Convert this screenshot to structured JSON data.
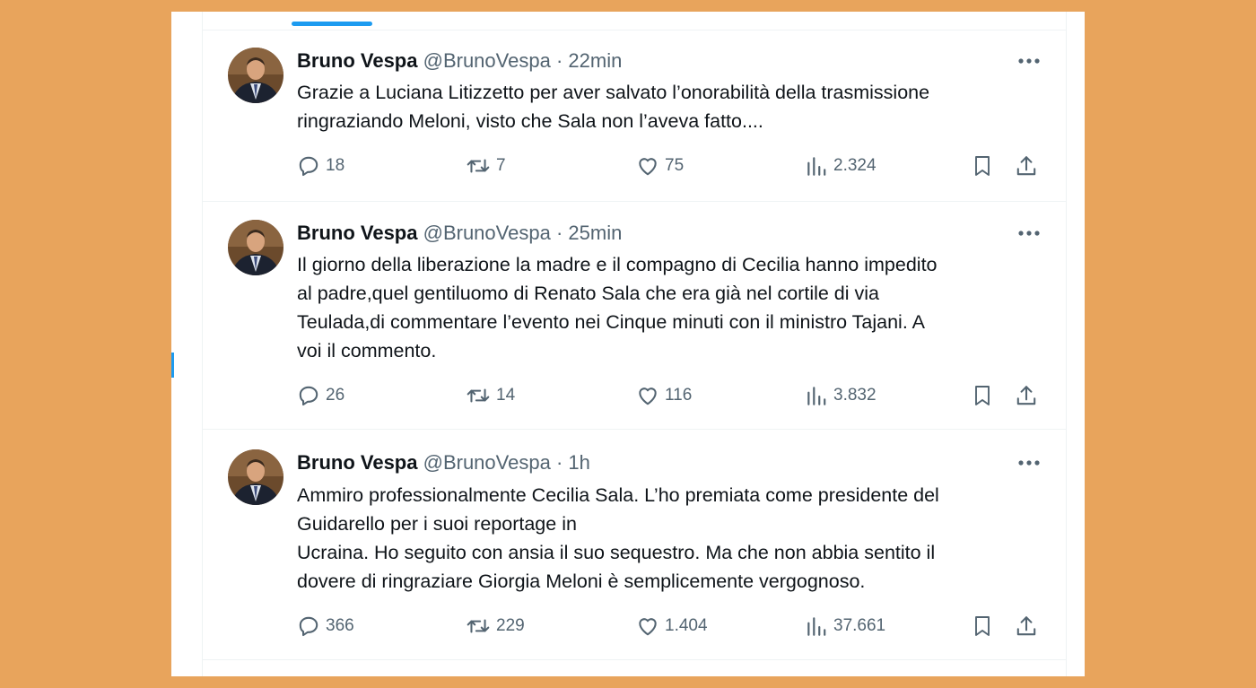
{
  "tweets": [
    {
      "author_name": "Bruno Vespa",
      "author_handle": "@BrunoVespa",
      "separator": "·",
      "time": "22min",
      "text": "Grazie a Luciana Litizzetto per aver salvato l’onorabilità della trasmissione\nringraziando Meloni, visto che Sala non l’aveva fatto....",
      "replies": "18",
      "retweets": "7",
      "likes": "75",
      "views": "2.324"
    },
    {
      "author_name": "Bruno Vespa",
      "author_handle": "@BrunoVespa",
      "separator": "·",
      "time": "25min",
      "text": "Il giorno della liberazione la madre e il compagno di Cecilia hanno impedito\nal padre,quel gentiluomo di Renato Sala che era già nel cortile di via\nTeulada,di commentare l’evento nei Cinque minuti con il ministro Tajani. A\nvoi il commento.",
      "replies": "26",
      "retweets": "14",
      "likes": "116",
      "views": "3.832"
    },
    {
      "author_name": "Bruno Vespa",
      "author_handle": "@BrunoVespa",
      "separator": "·",
      "time": "1h",
      "text": "Ammiro professionalmente Cecilia Sala. L’ho premiata come presidente del\nGuidarello per i suoi reportage in\nUcraina. Ho seguito con ansia il suo sequestro. Ma che non abbia sentito il\ndovere di ringraziare Giorgia Meloni è semplicemente vergognoso.",
      "replies": "366",
      "retweets": "229",
      "likes": "1.404",
      "views": "37.661"
    }
  ],
  "icons": {
    "more": "more-horizontal-icon",
    "reply": "reply-bubble-icon",
    "retweet": "retweet-icon",
    "like": "heart-icon",
    "views": "bar-chart-icon",
    "bookmark": "bookmark-icon",
    "share": "share-upload-icon"
  },
  "colors": {
    "background": "#e8a45c",
    "accent": "#1d9bf0",
    "text": "#0f1419",
    "secondary_text": "#536471"
  }
}
